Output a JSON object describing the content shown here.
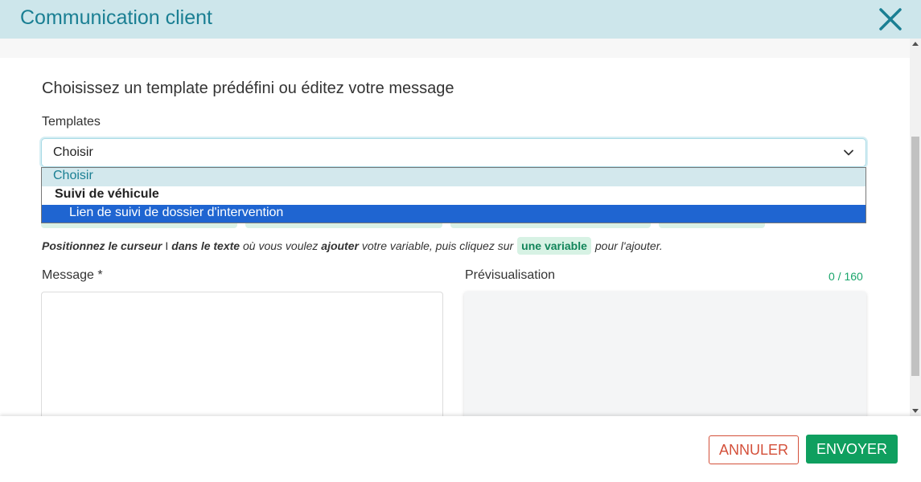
{
  "modal": {
    "title": "Communication client"
  },
  "intro": "Choisissez un template prédéfini ou éditez votre message",
  "templates": {
    "label": "Templates",
    "selected_value": "Choisir",
    "options": {
      "default": "Choisir",
      "group": "Suivi de véhicule",
      "highlighted": "Lien de suivi de dossier d'intervention"
    }
  },
  "hint": {
    "part1": "Positionnez le curseur",
    "cursor_glyph": "Ι",
    "part2": "dans le texte",
    "part3": "où vous voulez",
    "part4": "ajouter",
    "part5": "votre variable, puis cliquez sur",
    "chip": "une variable",
    "part6": "pour l'ajouter."
  },
  "message": {
    "label": "Message *",
    "value": ""
  },
  "preview": {
    "label": "Prévisualisation",
    "counter": "0 / 160"
  },
  "footer": {
    "cancel_label": "ANNULER",
    "send_label": "ENVOYER"
  },
  "colors": {
    "header_bg": "#cde6eb",
    "title": "#1a7f93",
    "send": "#0f9f5f",
    "cancel": "#d4503a",
    "option_highlight": "#1f65d1"
  },
  "icons": {
    "close": "close-icon",
    "chevron": "chevron-down-icon"
  }
}
